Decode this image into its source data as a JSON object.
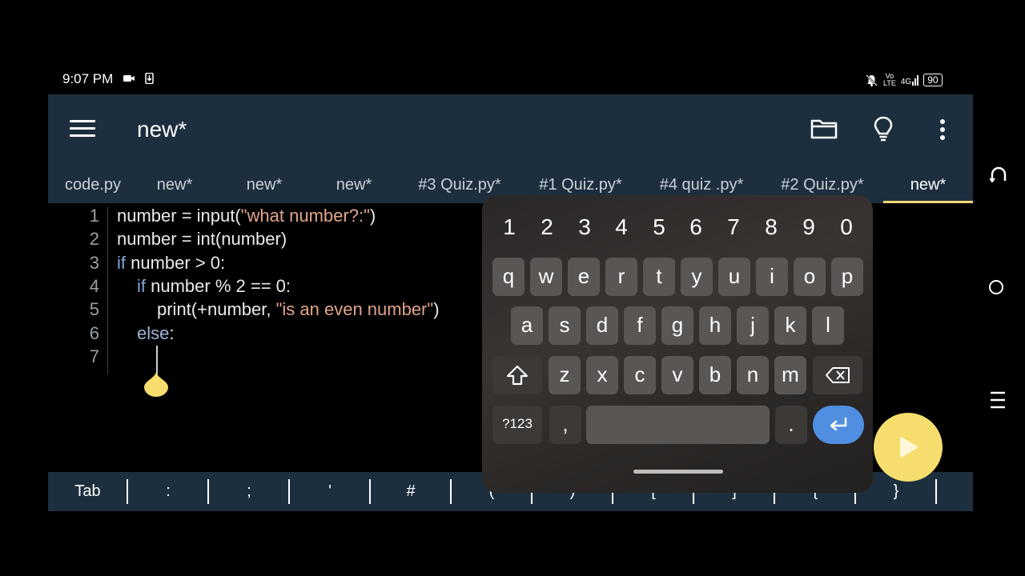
{
  "status_bar": {
    "time": "9:07 PM",
    "volte_top": "Vo",
    "volte_bottom": "LTE",
    "network": "4G",
    "battery": "90"
  },
  "app_bar": {
    "title": "new*"
  },
  "tabs": [
    "code.py",
    "new*",
    "new*",
    "new*",
    "#3 Quiz.py*",
    "#1 Quiz.py*",
    "#4 quiz .py*",
    "#2 Quiz.py*",
    "new*"
  ],
  "active_tab_index": 8,
  "editor": {
    "line_numbers": [
      "1",
      "2",
      "3",
      "4",
      "5",
      "6",
      "7"
    ],
    "lines": {
      "l1_a": "number = input(",
      "l1_s": "\"what number?:\"",
      "l1_b": ")",
      "l2": "number = int(number)",
      "l3_k": "if",
      "l3_b": " number > 0:",
      "l4_k": "if",
      "l4_b": " number % 2 == 0:",
      "l5_a": "print(+number, ",
      "l5_s": "\"is an even number\"",
      "l5_b": ")",
      "l6_k": "else",
      "l6_b": ":"
    }
  },
  "key_bar": [
    "Tab",
    ":",
    ";",
    "'",
    "#",
    "(",
    ")",
    "[",
    "]",
    "{",
    "}"
  ],
  "keyboard": {
    "numbers": [
      "1",
      "2",
      "3",
      "4",
      "5",
      "6",
      "7",
      "8",
      "9",
      "0"
    ],
    "row1": [
      "q",
      "w",
      "e",
      "r",
      "t",
      "y",
      "u",
      "i",
      "o",
      "p"
    ],
    "row2": [
      "a",
      "s",
      "d",
      "f",
      "g",
      "h",
      "j",
      "k",
      "l"
    ],
    "row3": [
      "z",
      "x",
      "c",
      "v",
      "b",
      "n",
      "m"
    ],
    "symbols_label": "?123",
    "comma": ",",
    "period": "."
  },
  "colors": {
    "app_bar": "#1d2f3e",
    "accent": "#f3d87a",
    "keyword": "#7ea7d8",
    "string": "#e0a48a",
    "enter_key": "#4f8ee0",
    "run_fab": "#f6dd6d"
  }
}
